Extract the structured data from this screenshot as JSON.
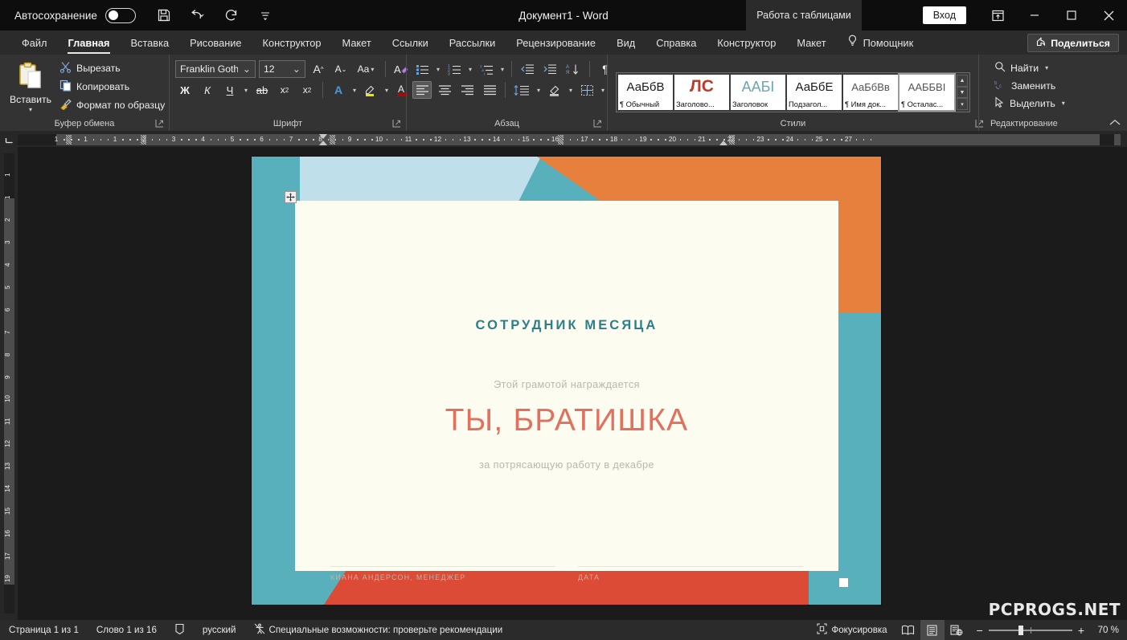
{
  "titlebar": {
    "autosave_label": "Автосохранение",
    "autosave_state": "off",
    "quick_access": [
      "save-icon",
      "undo-icon",
      "redo-icon",
      "customize-qat-icon"
    ],
    "document_title": "Документ1  -  Word",
    "contextual_tab": "Работа с таблицами",
    "signin_label": "Вход",
    "window_buttons": [
      "ribbon-display-options-icon",
      "minimize-icon",
      "maximize-icon",
      "close-icon"
    ]
  },
  "tabs": [
    {
      "label": "Файл",
      "active": false
    },
    {
      "label": "Главная",
      "active": true
    },
    {
      "label": "Вставка",
      "active": false
    },
    {
      "label": "Рисование",
      "active": false
    },
    {
      "label": "Конструктор",
      "active": false
    },
    {
      "label": "Макет",
      "active": false
    },
    {
      "label": "Ссылки",
      "active": false
    },
    {
      "label": "Рассылки",
      "active": false
    },
    {
      "label": "Рецензирование",
      "active": false
    },
    {
      "label": "Вид",
      "active": false
    },
    {
      "label": "Справка",
      "active": false
    },
    {
      "label": "Конструктор",
      "active": false
    },
    {
      "label": "Макет",
      "active": false
    }
  ],
  "helper_label": "Помощник",
  "share_label": "Поделиться",
  "ribbon": {
    "clipboard": {
      "group_label": "Буфер обмена",
      "paste_label": "Вставить",
      "cut_label": "Вырезать",
      "copy_label": "Копировать",
      "format_painter_label": "Формат по образцу"
    },
    "font": {
      "group_label": "Шрифт",
      "font_family": "Franklin Gothic",
      "font_size": "12",
      "grow_label": "A",
      "shrink_label": "A",
      "case_label": "Aa",
      "clear_format_label": "A",
      "bold_label": "Ж",
      "italic_label": "К",
      "underline_label": "Ч",
      "strike_label": "ab",
      "subscript_label": "x",
      "superscript_label": "x",
      "text_effects_label": "A",
      "highlight_label": "A",
      "fontcolor_label": "A"
    },
    "paragraph": {
      "group_label": "Абзац",
      "buttons": [
        "bullets-icon",
        "numbering-icon",
        "multilevel-list-icon",
        "decrease-indent-icon",
        "increase-indent-icon",
        "sort-icon",
        "show-marks-icon",
        "align-left-icon",
        "align-center-icon",
        "align-right-icon",
        "justify-icon",
        "line-spacing-icon",
        "shading-icon",
        "borders-icon"
      ],
      "pilcrow": "¶",
      "sort_label": "АЯ"
    },
    "styles": {
      "group_label": "Стили",
      "items": [
        {
          "preview": "АаБбВ",
          "name": "¶ Обычный",
          "color": "#1a1a1a",
          "selected": false
        },
        {
          "preview": "ЛС",
          "name": "Заголово...",
          "color": "#c0392b",
          "selected": false
        },
        {
          "preview": "ААБІ",
          "name": "Заголовок",
          "color": "#6aa8b0",
          "selected": false
        },
        {
          "preview": "АаБбЕ",
          "name": "Подзагол...",
          "color": "#1a1a1a",
          "selected": false
        },
        {
          "preview": "АаБбВв",
          "name": "¶ Имя док...",
          "color": "#555555",
          "selected": false
        },
        {
          "preview": "ААББВІ",
          "name": "¶ Осталас...",
          "color": "#555555",
          "selected": true
        }
      ]
    },
    "editing": {
      "group_label": "Редактирование",
      "find_label": "Найти",
      "replace_label": "Заменить",
      "select_label": "Выделить"
    }
  },
  "ruler": {
    "horizontal_ticks": [
      "1",
      "1",
      "1",
      "2",
      "3",
      "4",
      "5",
      "6",
      "7",
      "8",
      "9",
      "10",
      "11",
      "12",
      "13",
      "14",
      "15",
      "16",
      "17",
      "18",
      "19",
      "20",
      "21",
      "22",
      "23",
      "24",
      "25",
      "27"
    ],
    "vertical_ticks": [
      "1",
      "1",
      "2",
      "3",
      "4",
      "5",
      "6",
      "7",
      "8",
      "9",
      "10",
      "11",
      "12",
      "13",
      "14",
      "15",
      "16",
      "17",
      "19"
    ]
  },
  "document": {
    "certificate": {
      "title": "СОТРУДНИК МЕСЯЦА",
      "pre_text": "Этой грамотой награждается",
      "recipient": "ТЫ, БРАТИШКА",
      "reason": "за потрясающую работу в декабре",
      "signature_label": "КИАНА АНДЕРСОН, МЕНЕДЖЕР",
      "date_label": "ДАТА"
    },
    "colors": {
      "teal": "#58b0bd",
      "light_blue": "#bfe0ea",
      "orange": "#e8803d",
      "red": "#dc4b35",
      "cream": "#fdfcf1",
      "title_teal": "#2b7f8c",
      "name_red": "#e2705f",
      "muted": "#b9b7ae"
    }
  },
  "status": {
    "page_label": "Страница 1 из 1",
    "words_label": "Слово 1 из 16",
    "proofing_icon": "spellcheck-icon",
    "language_label": "русский",
    "accessibility_label": "Специальные возможности: проверьте рекомендации",
    "focus_label": "Фокусировка",
    "view_buttons": [
      "read-mode-icon",
      "print-layout-icon",
      "web-layout-icon"
    ],
    "active_view": "print-layout-icon",
    "zoom_out_label": "−",
    "zoom_in_label": "+",
    "zoom_level": "70 %"
  },
  "watermark": "PCPROGS.NET"
}
